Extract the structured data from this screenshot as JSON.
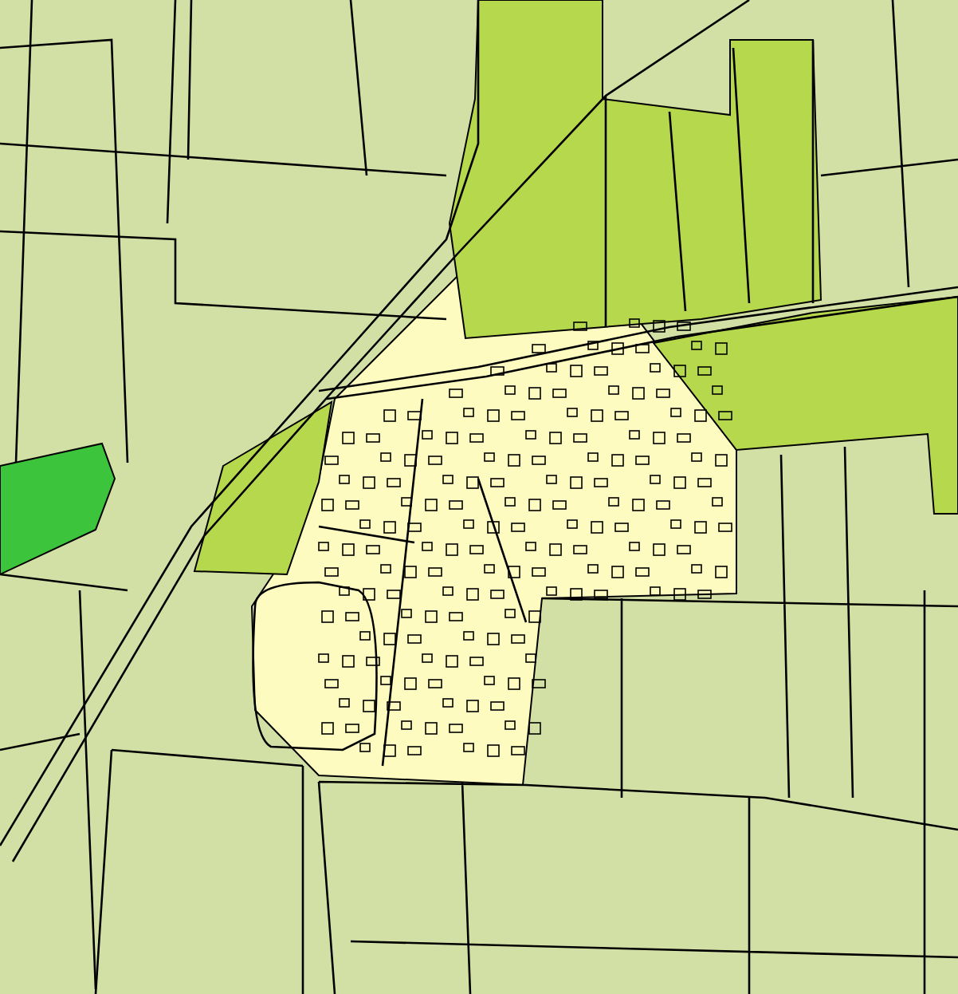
{
  "map": {
    "kind": "land-use",
    "areas": [
      {
        "kind": "farmland",
        "color": "#d3e0a5"
      },
      {
        "kind": "village",
        "color": "#fdfbbf"
      },
      {
        "kind": "field",
        "color": "#b6d84c"
      },
      {
        "kind": "park",
        "color": "#3cc43c"
      }
    ]
  }
}
